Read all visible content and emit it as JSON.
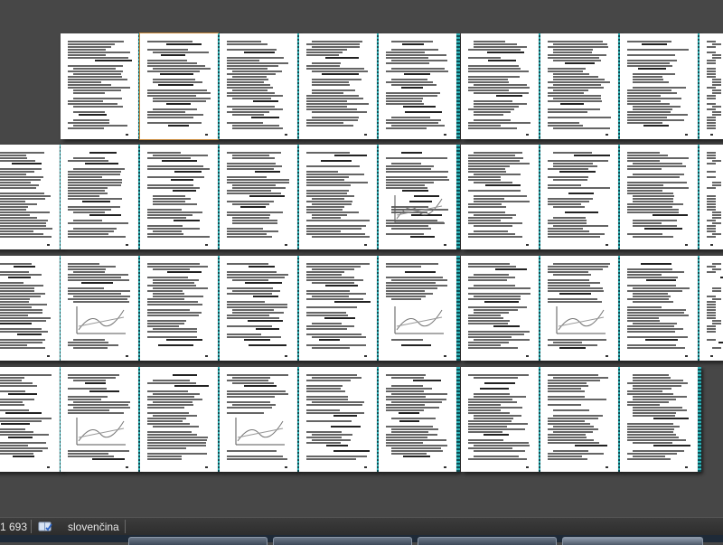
{
  "document": {
    "view": "multi-page thumbnail view",
    "selected_page": 2
  },
  "statusbar": {
    "word_count": "1 693",
    "proofing_icon": "proofing-book-icon",
    "language": "slovenčina"
  },
  "colors": {
    "workspace_bg": "#474747",
    "page_bg": "#ffffff",
    "margin_strip": "#2fb3b8",
    "selection_border": "#c98a3c"
  }
}
